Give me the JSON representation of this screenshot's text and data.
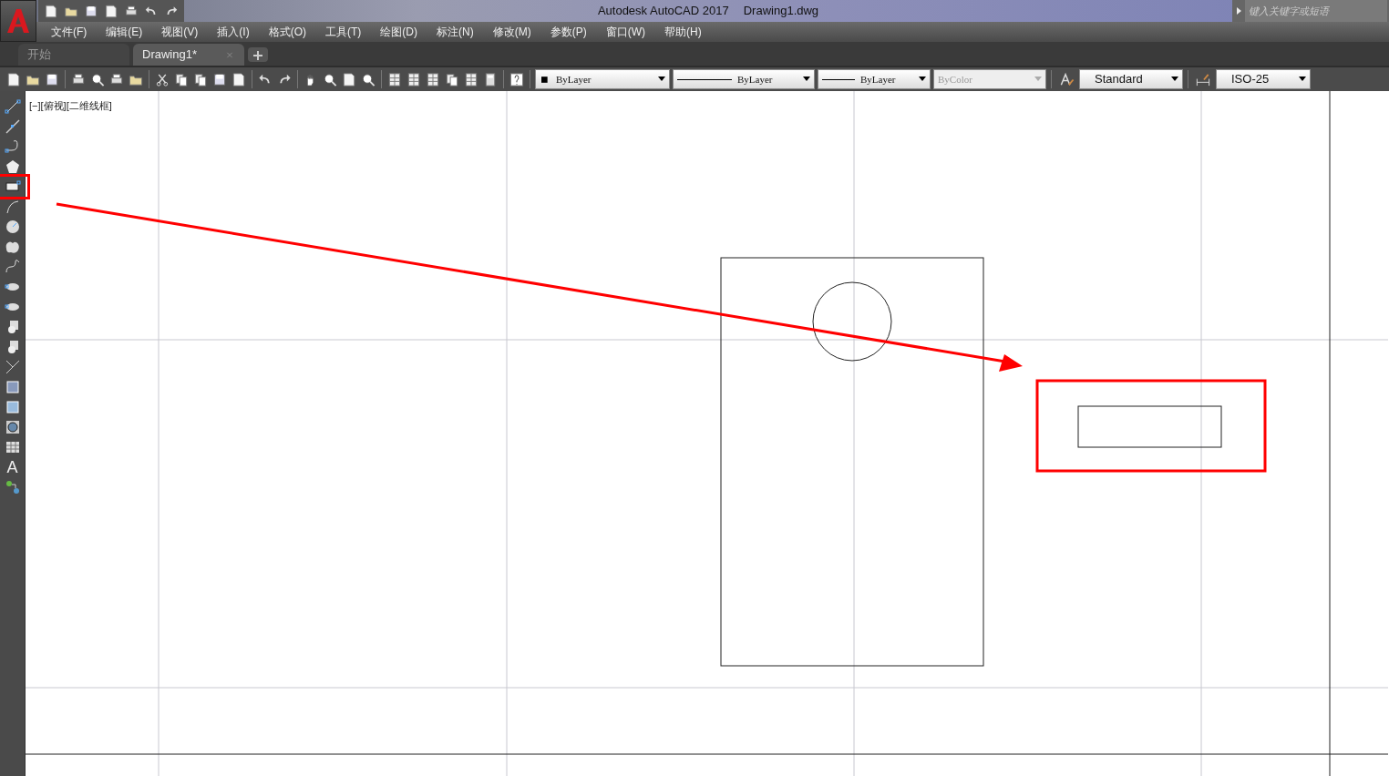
{
  "window": {
    "title": "Autodesk AutoCAD 2017",
    "document": "Drawing1.dwg"
  },
  "search": {
    "placeholder": "键入关键字或短语"
  },
  "menu": [
    "文件(F)",
    "编辑(E)",
    "视图(V)",
    "插入(I)",
    "格式(O)",
    "工具(T)",
    "绘图(D)",
    "标注(N)",
    "修改(M)",
    "参数(P)",
    "窗口(W)",
    "帮助(H)"
  ],
  "tabs": [
    {
      "label": "开始",
      "selected": false,
      "closable": false
    },
    {
      "label": "Drawing1*",
      "selected": true,
      "closable": true
    }
  ],
  "properties": [
    {
      "kind": "color",
      "value": "ByLayer",
      "disabled": false
    },
    {
      "kind": "line",
      "value": "ByLayer",
      "disabled": false
    },
    {
      "kind": "line",
      "value": "ByLayer",
      "disabled": false
    },
    {
      "kind": "plain",
      "value": "ByColor",
      "disabled": true
    }
  ],
  "styles": [
    {
      "kind": "text-style",
      "value": "Standard"
    },
    {
      "kind": "dim-style",
      "value": "ISO-25"
    }
  ],
  "draw_tools": [
    {
      "kind": "line",
      "highlighted": false
    },
    {
      "kind": "xline",
      "highlighted": false
    },
    {
      "kind": "pline",
      "highlighted": false
    },
    {
      "kind": "polygon",
      "highlighted": false
    },
    {
      "kind": "rect",
      "highlighted": true
    },
    {
      "kind": "arc",
      "highlighted": false
    },
    {
      "kind": "circle",
      "highlighted": false
    },
    {
      "kind": "cloud",
      "highlighted": false
    },
    {
      "kind": "spline",
      "highlighted": false
    },
    {
      "kind": "ellipse",
      "highlighted": false
    },
    {
      "kind": "ellipse",
      "highlighted": false
    },
    {
      "kind": "block",
      "highlighted": false
    },
    {
      "kind": "block",
      "highlighted": false
    },
    {
      "kind": "point",
      "highlighted": false
    },
    {
      "kind": "hatch",
      "highlighted": false
    },
    {
      "kind": "gradient",
      "highlighted": false
    },
    {
      "kind": "region",
      "highlighted": false
    },
    {
      "kind": "table",
      "highlighted": false
    },
    {
      "kind": "text",
      "glyph": "A",
      "highlighted": false
    },
    {
      "kind": "add",
      "highlighted": false
    }
  ],
  "viewport": {
    "label": "[−][俯视][二维线框]"
  }
}
